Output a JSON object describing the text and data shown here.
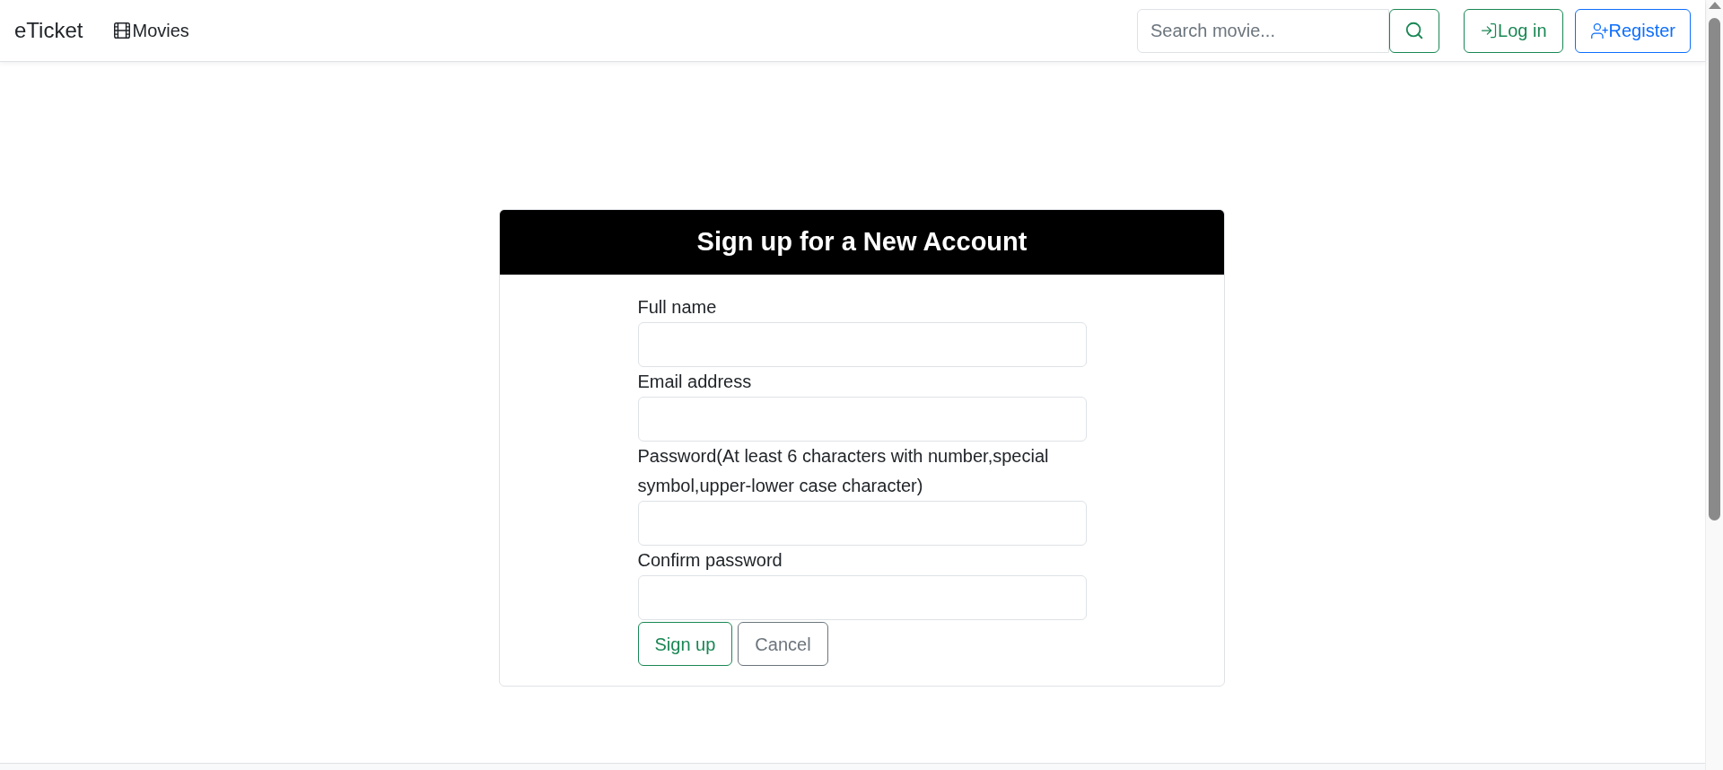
{
  "navbar": {
    "brand": "eTicket",
    "links": [
      {
        "label": "Movies"
      }
    ],
    "search": {
      "placeholder": "Search movie..."
    },
    "auth_buttons": [
      {
        "label": "Log in",
        "kind": "login"
      },
      {
        "label": "Register",
        "kind": "register"
      }
    ]
  },
  "form": {
    "title": "Sign up for a New Account",
    "fields": [
      {
        "label": "Full name"
      },
      {
        "label": "Email address"
      },
      {
        "label": "Password(At least 6 characters with number,special symbol,upper-lower case character)"
      },
      {
        "label": "Confirm password"
      }
    ],
    "buttons": [
      {
        "label": "Sign up",
        "kind": "primary"
      },
      {
        "label": "Cancel",
        "kind": "secondary"
      }
    ]
  }
}
